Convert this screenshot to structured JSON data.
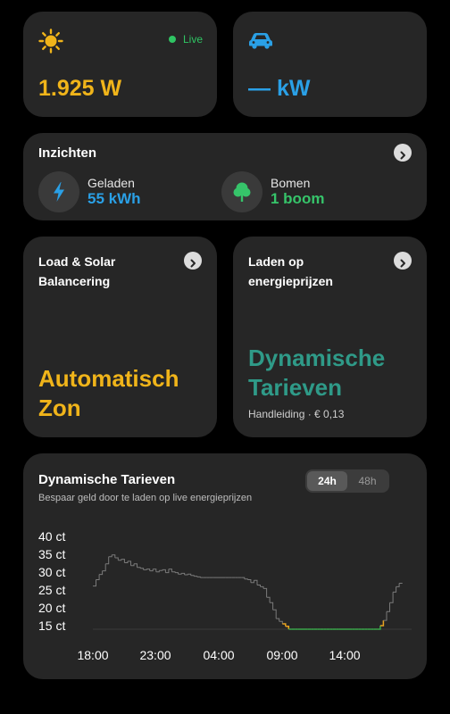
{
  "solar": {
    "live_label": "Live",
    "power": "1.925 W"
  },
  "car": {
    "power": "— kW"
  },
  "insights": {
    "title": "Inzichten",
    "charged_label": "Geladen",
    "charged_value": "55 kWh",
    "trees_label": "Bomen",
    "trees_value": "1 boom"
  },
  "balancing": {
    "title_line1": "Load & Solar",
    "title_line2": "Balancering",
    "mode_line1": "Automatisch",
    "mode_line2": "Zon"
  },
  "price_charging": {
    "title_line1": "Laden op",
    "title_line2": "energieprijzen",
    "mode_line1": "Dynamische",
    "mode_line2": "Tarieven",
    "subtitle": "Handleiding · € 0,13"
  },
  "tariff_chart": {
    "title": "Dynamische Tarieven",
    "subtitle": "Bespaar geld door te laden op live energieprijzen",
    "range_options": [
      "24h",
      "48h"
    ],
    "range_selected": "24h"
  },
  "colors": {
    "solar": "#f0b41a",
    "car": "#2aa0e6",
    "charged": "#2aa0e6",
    "trees": "#36c46a",
    "live_dot": "#2fc463",
    "dynamic": "#2f9a88",
    "price_line": "#7a7a7a",
    "cheap_line": "#3aa64a",
    "mid_line": "#e8a320"
  },
  "chart_data": {
    "type": "line",
    "title": "Dynamische Tarieven",
    "x_ticks": [
      "18:00",
      "23:00",
      "04:00",
      "09:00",
      "14:00"
    ],
    "y_ticks": [
      "40 ct",
      "35 ct",
      "30 ct",
      "25 ct",
      "20 ct",
      "15 ct"
    ],
    "ylim": [
      15,
      40
    ],
    "y_unit": "ct",
    "x_start_hour": 18,
    "x_span_hours": 25,
    "series": [
      {
        "hours": [
          18.0,
          18.25,
          18.5,
          18.75,
          19.0,
          19.25,
          19.5,
          19.75,
          20.0,
          20.25,
          20.5,
          20.75,
          21.0,
          21.25,
          21.5,
          21.75,
          22.0,
          22.25,
          22.5,
          22.75,
          23.0,
          23.25,
          23.5,
          23.75,
          0.0,
          0.25,
          0.5,
          0.75,
          1.0,
          1.25,
          1.5,
          1.75,
          2.0,
          2.25,
          2.5,
          2.75,
          3.0,
          3.25,
          3.5,
          3.75,
          4.0,
          4.25,
          4.5,
          4.75,
          5.0,
          5.25,
          5.5,
          5.75,
          6.0,
          6.25,
          6.5,
          6.75,
          7.0,
          7.25,
          7.5,
          7.75,
          8.0,
          8.25,
          8.5,
          8.75,
          9.0,
          9.25,
          9.5,
          9.75,
          10.0,
          10.25,
          10.5,
          10.75,
          11.0,
          11.25,
          11.5,
          11.75,
          12.0,
          12.25,
          12.5,
          12.75,
          13.0,
          13.25,
          13.5,
          13.75,
          14.0,
          14.25,
          14.5,
          14.75,
          15.0,
          15.25,
          15.5,
          15.75,
          16.0,
          16.25,
          16.5,
          16.75,
          17.0,
          17.25,
          17.5,
          17.75,
          18.0,
          18.25,
          18.5
        ],
        "values": [
          26.2,
          28.0,
          29.5,
          30.5,
          32.5,
          34.5,
          35.0,
          34.2,
          33.5,
          33.8,
          32.8,
          33.2,
          32.0,
          32.5,
          31.5,
          31.2,
          30.8,
          31.0,
          30.5,
          31.0,
          30.2,
          30.6,
          30.8,
          30.0,
          31.0,
          30.2,
          30.0,
          29.6,
          29.8,
          29.4,
          29.6,
          29.2,
          29.0,
          28.8,
          28.6,
          28.6,
          28.6,
          28.6,
          28.6,
          28.6,
          28.6,
          28.6,
          28.6,
          28.6,
          28.6,
          28.6,
          28.6,
          28.6,
          28.2,
          28.0,
          27.2,
          27.8,
          26.5,
          26.0,
          25.5,
          23.0,
          21.5,
          19.5,
          17.0,
          16.2,
          15.5,
          14.8,
          14.0,
          14.0,
          14.0,
          14.0,
          14.0,
          14.0,
          14.0,
          14.0,
          14.0,
          14.0,
          14.0,
          14.0,
          14.0,
          14.0,
          14.0,
          14.0,
          14.0,
          14.0,
          14.0,
          14.0,
          14.0,
          14.0,
          14.0,
          14.0,
          14.0,
          14.0,
          14.0,
          14.0,
          14.0,
          15.0,
          16.5,
          19.0,
          21.5,
          24.5,
          26.0,
          27.0,
          27.0
        ]
      }
    ],
    "grid": false
  }
}
